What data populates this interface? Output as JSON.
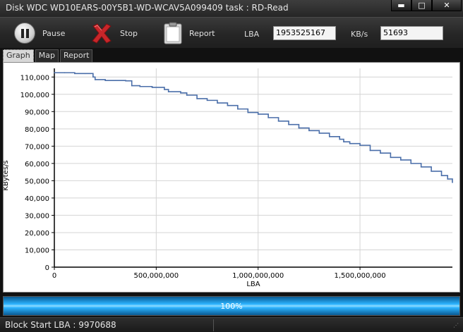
{
  "window": {
    "title": "Disk WDC WD10EARS-00Y5B1-WD-WCAV5A099409   task : RD-Read",
    "minimize": "▬",
    "maximize": "□",
    "close": "✕"
  },
  "toolbar": {
    "pause_label": "Pause",
    "stop_label": "Stop",
    "report_label": "Report",
    "lba_label": "LBA",
    "lba_value": "1953525167",
    "kbs_label": "KB/s",
    "kbs_value": "51693"
  },
  "tabs": [
    {
      "label": "Graph",
      "active": true
    },
    {
      "label": "Map",
      "active": false
    },
    {
      "label": "Report",
      "active": false
    }
  ],
  "icons": {
    "pause": "pause-icon",
    "stop": "stop-x-icon",
    "report": "clipboard-icon"
  },
  "chart_data": {
    "type": "line",
    "xlabel": "LBA",
    "ylabel": "KBytes/s",
    "xlim": [
      0,
      1953525167
    ],
    "ylim": [
      0,
      115000
    ],
    "xticks": [
      0,
      500000000,
      1000000000,
      1500000000
    ],
    "xtick_labels": [
      "0",
      "500,000,000",
      "1,000,000,000",
      "1,500,000,000"
    ],
    "yticks": [
      0,
      10000,
      20000,
      30000,
      40000,
      50000,
      60000,
      70000,
      80000,
      90000,
      100000,
      110000
    ],
    "ytick_labels": [
      "0",
      "10,000",
      "20,000",
      "30,000",
      "40,000",
      "50,000",
      "60,000",
      "70,000",
      "80,000",
      "90,000",
      "100,000",
      "110,000"
    ],
    "grid": true,
    "line_color": "#4a6ea9",
    "series": [
      {
        "x": [
          0,
          50000000,
          100000000,
          150000000,
          190000000,
          200000000,
          250000000,
          300000000,
          350000000,
          380000000,
          420000000,
          480000000,
          540000000,
          560000000,
          620000000,
          650000000,
          700000000,
          750000000,
          800000000,
          850000000,
          900000000,
          950000000,
          1000000000,
          1050000000,
          1100000000,
          1150000000,
          1200000000,
          1250000000,
          1300000000,
          1350000000,
          1400000000,
          1420000000,
          1450000000,
          1500000000,
          1550000000,
          1600000000,
          1650000000,
          1700000000,
          1750000000,
          1800000000,
          1850000000,
          1900000000,
          1930000000,
          1953525167
        ],
        "y": [
          112500,
          112500,
          112000,
          112000,
          110000,
          108500,
          108000,
          108000,
          107800,
          105000,
          104500,
          104000,
          102800,
          101500,
          100800,
          99500,
          97500,
          96500,
          95000,
          93500,
          91500,
          89500,
          88500,
          86500,
          84500,
          82500,
          80500,
          79000,
          77500,
          75500,
          74000,
          72500,
          71500,
          70500,
          67500,
          66000,
          63500,
          62000,
          60000,
          58000,
          55500,
          53000,
          51000,
          49000
        ]
      }
    ]
  },
  "progress": {
    "percent_text": "100%",
    "value": 1.0
  },
  "status": {
    "text": "Block Start LBA : 9970688"
  }
}
